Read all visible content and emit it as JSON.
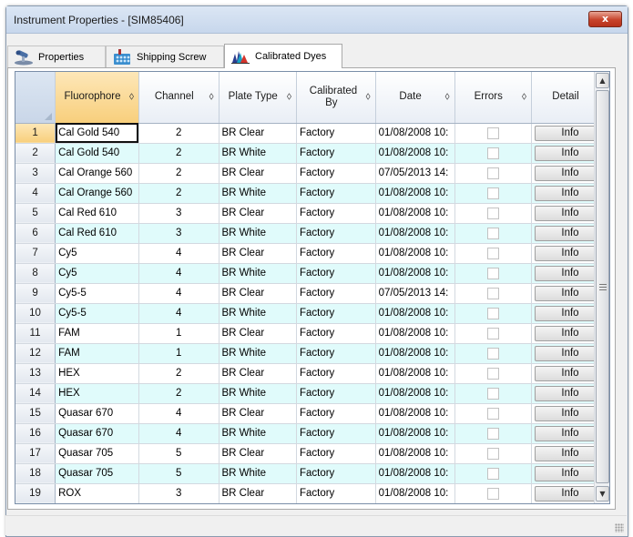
{
  "window": {
    "title": "Instrument Properties - [SIM85406]",
    "close_label": "x"
  },
  "tabs": [
    {
      "label": "Properties",
      "icon": "microscope-icon"
    },
    {
      "label": "Shipping Screw",
      "icon": "plate-icon"
    },
    {
      "label": "Calibrated Dyes",
      "icon": "spectrum-chart-icon",
      "active": true
    }
  ],
  "grid": {
    "columns": [
      "Fluorophore",
      "Channel",
      "Plate Type",
      "Calibrated By",
      "Date",
      "Errors",
      "Detail"
    ],
    "sort_glyph": "◊",
    "info_label": "Info",
    "rows": [
      {
        "n": "1",
        "fluorophore": "Cal Gold 540",
        "channel": "2",
        "plate": "BR Clear",
        "cal": "Factory",
        "date": "01/08/2008 10:"
      },
      {
        "n": "2",
        "fluorophore": "Cal Gold 540",
        "channel": "2",
        "plate": "BR White",
        "cal": "Factory",
        "date": "01/08/2008 10:"
      },
      {
        "n": "3",
        "fluorophore": "Cal Orange 560",
        "channel": "2",
        "plate": "BR Clear",
        "cal": "Factory",
        "date": "07/05/2013 14:"
      },
      {
        "n": "4",
        "fluorophore": "Cal Orange 560",
        "channel": "2",
        "plate": "BR White",
        "cal": "Factory",
        "date": "01/08/2008 10:"
      },
      {
        "n": "5",
        "fluorophore": "Cal Red 610",
        "channel": "3",
        "plate": "BR Clear",
        "cal": "Factory",
        "date": "01/08/2008 10:"
      },
      {
        "n": "6",
        "fluorophore": "Cal Red 610",
        "channel": "3",
        "plate": "BR White",
        "cal": "Factory",
        "date": "01/08/2008 10:"
      },
      {
        "n": "7",
        "fluorophore": "Cy5",
        "channel": "4",
        "plate": "BR Clear",
        "cal": "Factory",
        "date": "01/08/2008 10:"
      },
      {
        "n": "8",
        "fluorophore": "Cy5",
        "channel": "4",
        "plate": "BR White",
        "cal": "Factory",
        "date": "01/08/2008 10:"
      },
      {
        "n": "9",
        "fluorophore": "Cy5-5",
        "channel": "4",
        "plate": "BR Clear",
        "cal": "Factory",
        "date": "07/05/2013 14:"
      },
      {
        "n": "10",
        "fluorophore": "Cy5-5",
        "channel": "4",
        "plate": "BR White",
        "cal": "Factory",
        "date": "01/08/2008 10:"
      },
      {
        "n": "11",
        "fluorophore": "FAM",
        "channel": "1",
        "plate": "BR Clear",
        "cal": "Factory",
        "date": "01/08/2008 10:"
      },
      {
        "n": "12",
        "fluorophore": "FAM",
        "channel": "1",
        "plate": "BR White",
        "cal": "Factory",
        "date": "01/08/2008 10:"
      },
      {
        "n": "13",
        "fluorophore": "HEX",
        "channel": "2",
        "plate": "BR Clear",
        "cal": "Factory",
        "date": "01/08/2008 10:"
      },
      {
        "n": "14",
        "fluorophore": "HEX",
        "channel": "2",
        "plate": "BR White",
        "cal": "Factory",
        "date": "01/08/2008 10:"
      },
      {
        "n": "15",
        "fluorophore": "Quasar 670",
        "channel": "4",
        "plate": "BR Clear",
        "cal": "Factory",
        "date": "01/08/2008 10:"
      },
      {
        "n": "16",
        "fluorophore": "Quasar 670",
        "channel": "4",
        "plate": "BR White",
        "cal": "Factory",
        "date": "01/08/2008 10:"
      },
      {
        "n": "17",
        "fluorophore": "Quasar 705",
        "channel": "5",
        "plate": "BR Clear",
        "cal": "Factory",
        "date": "01/08/2008 10:"
      },
      {
        "n": "18",
        "fluorophore": "Quasar 705",
        "channel": "5",
        "plate": "BR White",
        "cal": "Factory",
        "date": "01/08/2008 10:"
      },
      {
        "n": "19",
        "fluorophore": "ROX",
        "channel": "3",
        "plate": "BR Clear",
        "cal": "Factory",
        "date": "01/08/2008 10:"
      }
    ]
  },
  "colors": {
    "alt_row": "#e0fbfb",
    "selected_header": "#f8cf7c",
    "close_button": "#c7432b"
  }
}
